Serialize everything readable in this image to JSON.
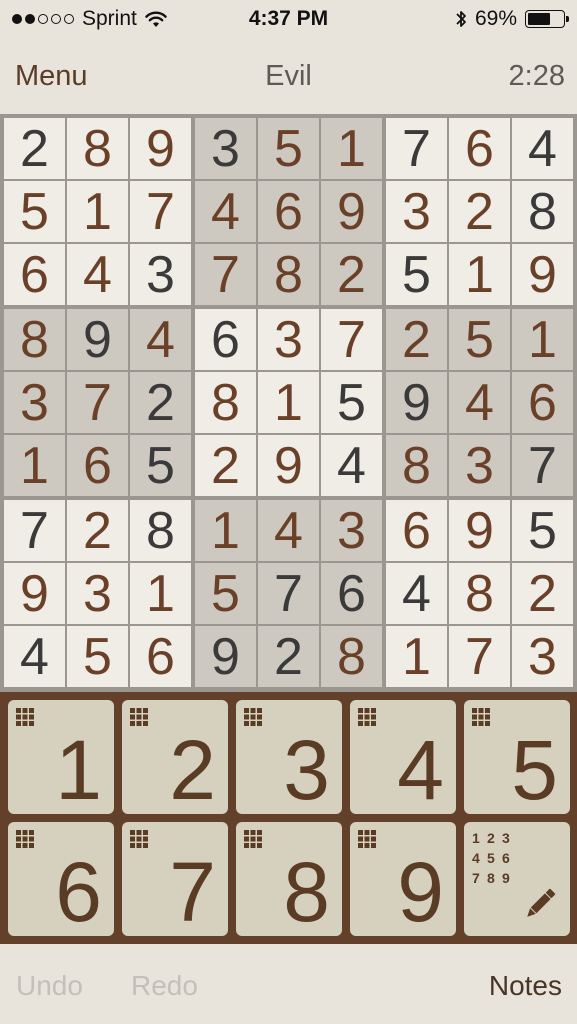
{
  "status_bar": {
    "carrier": "Sprint",
    "time": "4:37 PM",
    "battery_text": "69%",
    "battery_level": 0.69,
    "signal_bars_filled": 2,
    "signal_bars_total": 5
  },
  "nav": {
    "menu_label": "Menu",
    "difficulty": "Evil",
    "timer": "2:28"
  },
  "board": {
    "rows": [
      [
        "2",
        "8",
        "9",
        "3",
        "5",
        "1",
        "7",
        "6",
        "4"
      ],
      [
        "5",
        "1",
        "7",
        "4",
        "6",
        "9",
        "3",
        "2",
        "8"
      ],
      [
        "6",
        "4",
        "3",
        "7",
        "8",
        "2",
        "5",
        "1",
        "9"
      ],
      [
        "8",
        "9",
        "4",
        "6",
        "3",
        "7",
        "2",
        "5",
        "1"
      ],
      [
        "3",
        "7",
        "2",
        "8",
        "1",
        "5",
        "9",
        "4",
        "6"
      ],
      [
        "1",
        "6",
        "5",
        "2",
        "9",
        "4",
        "8",
        "3",
        "7"
      ],
      [
        "7",
        "2",
        "8",
        "1",
        "4",
        "3",
        "6",
        "9",
        "5"
      ],
      [
        "9",
        "3",
        "1",
        "5",
        "7",
        "6",
        "4",
        "8",
        "2"
      ],
      [
        "4",
        "5",
        "6",
        "9",
        "2",
        "8",
        "1",
        "7",
        "3"
      ]
    ],
    "given": [
      [
        1,
        0,
        0,
        1,
        0,
        0,
        1,
        0,
        1
      ],
      [
        0,
        0,
        0,
        0,
        0,
        0,
        0,
        0,
        1
      ],
      [
        0,
        0,
        1,
        0,
        0,
        0,
        1,
        0,
        0
      ],
      [
        0,
        1,
        0,
        1,
        0,
        0,
        0,
        0,
        0
      ],
      [
        0,
        0,
        1,
        0,
        0,
        1,
        1,
        0,
        0
      ],
      [
        0,
        0,
        1,
        0,
        0,
        1,
        0,
        0,
        1
      ],
      [
        1,
        0,
        1,
        0,
        0,
        0,
        0,
        0,
        1
      ],
      [
        0,
        0,
        0,
        0,
        1,
        1,
        1,
        0,
        0
      ],
      [
        1,
        0,
        0,
        1,
        1,
        0,
        0,
        0,
        0
      ]
    ]
  },
  "keypad": {
    "digits": [
      "1",
      "2",
      "3",
      "4",
      "5",
      "6",
      "7",
      "8",
      "9"
    ],
    "notes_digits": [
      "1",
      "2",
      "3",
      "4",
      "5",
      "6",
      "7",
      "8",
      "9"
    ]
  },
  "toolbar": {
    "undo_label": "Undo",
    "redo_label": "Redo",
    "notes_label": "Notes"
  },
  "colors": {
    "given_digit": "#3a3a3a",
    "user_digit": "#6a4128",
    "light_box": "#f0ede6",
    "dark_box": "#cdc9c1",
    "keypad_bg": "#62402a",
    "key_face": "#d6d0be"
  },
  "icons": {
    "wifi": "wifi-icon",
    "bluetooth": "bluetooth-icon",
    "battery": "battery-icon",
    "mini_grid": "grid-icon",
    "pencil": "pencil-icon"
  }
}
